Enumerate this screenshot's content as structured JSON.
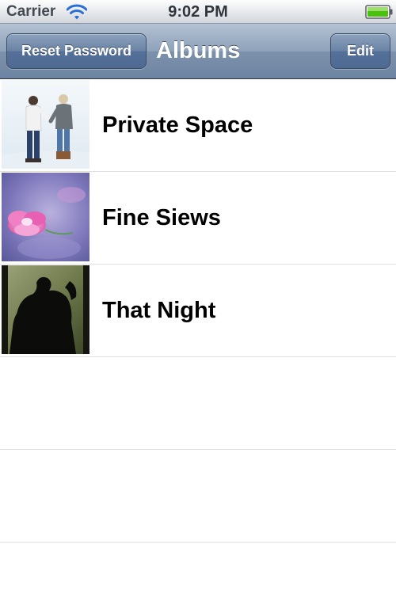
{
  "status_bar": {
    "carrier": "Carrier",
    "time": "9:02 PM",
    "wifi_icon": "wifi-icon",
    "battery_icon": "battery-full-icon",
    "battery_color": "#4ac10f"
  },
  "nav_bar": {
    "title": "Albums",
    "left_button": "Reset Password",
    "right_button": "Edit",
    "tint_color": "#6d84a2"
  },
  "albums": [
    {
      "name": "Private Space",
      "thumbnail": "couple-walking-in-snow-photo"
    },
    {
      "name": "Fine Siews",
      "thumbnail": "pink-rose-photo"
    },
    {
      "name": "That Night",
      "thumbnail": "couple-silhouette-photo"
    }
  ]
}
